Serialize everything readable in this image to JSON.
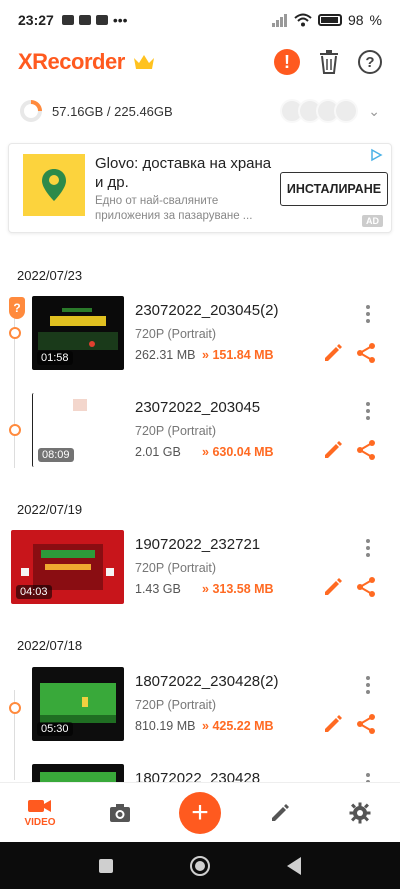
{
  "status_bar": {
    "time": "23:27",
    "battery": "98"
  },
  "header": {
    "logo": "XRecorder"
  },
  "storage": {
    "text": "57.16GB / 225.46GB"
  },
  "ad": {
    "title": "Glovo: доставка на храна и др.",
    "description": "Едно от най-сваляните приложения за пазаруване ...",
    "install_label": "ИНСТАЛИРАНЕ",
    "badge": "AD"
  },
  "groups": [
    {
      "date": "2022/07/23",
      "items": [
        {
          "name": "23072022_203045(2)",
          "resolution": "720P (Portrait)",
          "size": "262.31 MB",
          "saved": "151.84 MB",
          "duration": "01:58",
          "thumb_color": "#0a0a0a",
          "accent": "#e0c020"
        },
        {
          "name": "23072022_203045",
          "resolution": "720P (Portrait)",
          "size": "2.01 GB",
          "saved": "630.04 MB",
          "duration": "08:09",
          "thumb_color": "#ffffff",
          "accent": "#f3d6cc"
        }
      ]
    },
    {
      "date": "2022/07/19",
      "items": [
        {
          "name": "19072022_232721",
          "resolution": "720P (Portrait)",
          "size": "1.43 GB",
          "saved": "313.58 MB",
          "duration": "04:03",
          "thumb_color": "#c8151b",
          "accent": "#2d9a3a"
        }
      ]
    },
    {
      "date": "2022/07/18",
      "items": [
        {
          "name": "18072022_230428(2)",
          "resolution": "720P (Portrait)",
          "size": "810.19 MB",
          "saved": "425.22 MB",
          "duration": "05:30",
          "thumb_color": "#0d0d0d",
          "accent": "#39a93a"
        },
        {
          "name": "18072022_230428",
          "resolution": "",
          "size": "",
          "saved": "",
          "duration": "",
          "thumb_color": "#0d0d0d",
          "accent": "#39a93a"
        }
      ]
    }
  ],
  "bottom_nav": {
    "video_label": "VIDEO"
  },
  "colors": {
    "brand": "#ff5a1f",
    "saved": "#ff6a22"
  }
}
